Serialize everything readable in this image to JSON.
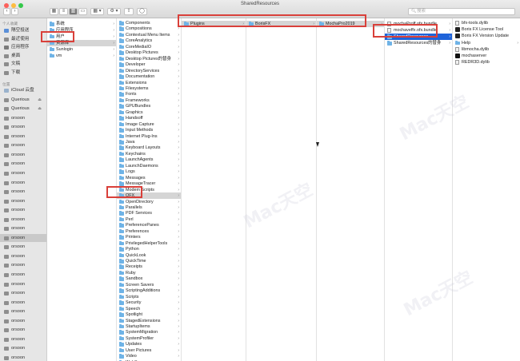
{
  "window": {
    "title": "SharedResources"
  },
  "toolbar": {
    "search_placeholder": "搜索"
  },
  "sidebar": {
    "favorites_header": "个人收藏",
    "favorites": [
      {
        "label": "隔空投送"
      },
      {
        "label": "最近使用"
      },
      {
        "label": "应用程序"
      },
      {
        "label": "桌面"
      },
      {
        "label": "文稿"
      },
      {
        "label": "下载"
      }
    ],
    "locations_header": "位置",
    "locations": [
      {
        "label": "iCloud 云盘"
      },
      {
        "label": "Querious",
        "eject": "⏏"
      },
      {
        "label": "Querious",
        "eject": "⏏"
      },
      {
        "label": "orsoon"
      },
      {
        "label": "orsoon"
      },
      {
        "label": "orsoon"
      },
      {
        "label": "orsoon"
      },
      {
        "label": "orsoon"
      },
      {
        "label": "orsoon"
      },
      {
        "label": "orsoon"
      },
      {
        "label": "orsoon"
      },
      {
        "label": "orsoon"
      },
      {
        "label": "orsoon"
      },
      {
        "label": "orsoon"
      },
      {
        "label": "orsoon"
      },
      {
        "label": "orsoon"
      },
      {
        "label": "orsoon"
      },
      {
        "label": "orsoon"
      },
      {
        "label": "orsoon"
      },
      {
        "label": "orsoon"
      },
      {
        "label": "orsoon"
      },
      {
        "label": "orsoon"
      },
      {
        "label": "orsoon"
      },
      {
        "label": "orsoon"
      },
      {
        "label": "orsoon"
      },
      {
        "label": "orsoon"
      },
      {
        "label": "orsoon"
      },
      {
        "label": "orsoon"
      },
      {
        "label": "orsoon"
      },
      {
        "label": "orsoon"
      },
      {
        "label": "orsoon"
      }
    ]
  },
  "columns": {
    "col1": [
      "系统",
      "应用程序",
      "用户",
      "资源库",
      "Sunlogin",
      "vm"
    ],
    "col2": [
      "Components",
      "Compositions",
      "Contextual Menu Items",
      "CoreAnalytics",
      "CoreMediaIO",
      "Desktop Pictures",
      "Desktop Pictures的替身",
      "Developer",
      "DirectoryServices",
      "Documentation",
      "Extensions",
      "Filesystems",
      "Fonts",
      "Frameworks",
      "GPUBundles",
      "Graphics",
      "Handsoff",
      "Image Capture",
      "Input Methods",
      "Internet Plug-Ins",
      "Java",
      "Keyboard Layouts",
      "Keychains",
      "LaunchAgents",
      "LaunchDaemons",
      "Logs",
      "Messages",
      "MessageTracer",
      "Modem Scripts",
      "OFX",
      "OpenDirectory",
      "Parallels",
      "PDF Services",
      "Perl",
      "PreferencePanes",
      "Preferences",
      "Printers",
      "PrivilegedHelperTools",
      "Python",
      "QuickLook",
      "QuickTime",
      "Receipts",
      "Ruby",
      "Sandbox",
      "Screen Savers",
      "ScriptingAdditions",
      "Scripts",
      "Security",
      "Speech",
      "Spotlight",
      "StagedExtensions",
      "StartupItems",
      "SystemMigration",
      "SystemProfiler",
      "Updates",
      "User Pictures",
      "Video",
      "WebServer"
    ],
    "col3": [
      "Plugins"
    ],
    "col4": [
      "BorisFX"
    ],
    "col5": [
      "MochaPro2019"
    ],
    "col6": [
      "mochaProff.ofx.bundle",
      "mochaveffx.ofx.bundle",
      "SharedResources",
      "SharedResources的替身"
    ],
    "col7": [
      "bfx-tools.dylib",
      "Boris FX License Tool",
      "Boris FX Version Update",
      "Help",
      "libmocha.dylib",
      "mochaserver",
      "REDR3D.dylib"
    ]
  },
  "watermark": "Mac天空"
}
